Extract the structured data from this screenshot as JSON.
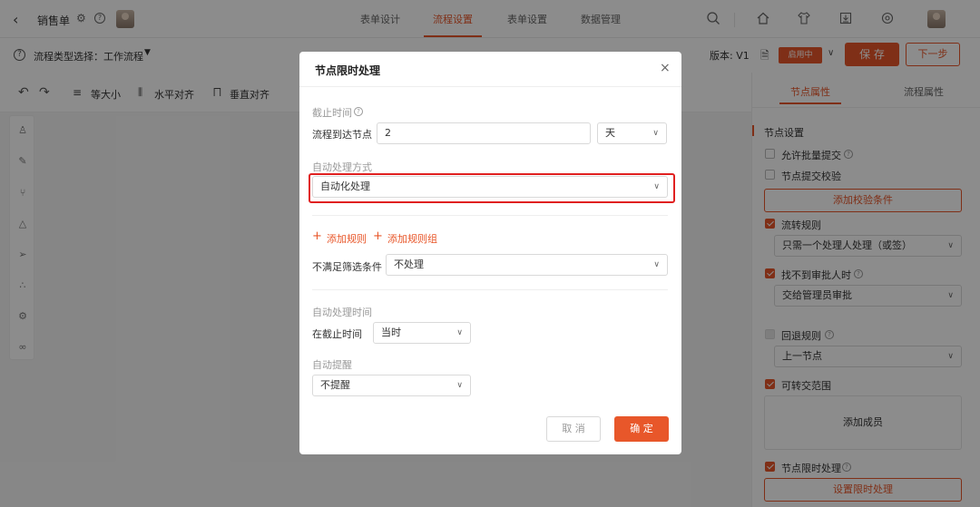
{
  "header": {
    "title": "销售单",
    "tabs": [
      {
        "label": "表单设计"
      },
      {
        "label": "流程设置"
      },
      {
        "label": "表单设置"
      },
      {
        "label": "数据管理"
      }
    ]
  },
  "subheader": {
    "flow_type_label": "流程类型选择：工作流程",
    "version_label": "版本: V1",
    "status_badge": "启用中",
    "save_label": "保 存",
    "next_label": "下一步"
  },
  "toolbar": {
    "same_size": "等大小",
    "h_align": "水平对齐",
    "v_align": "垂直对齐"
  },
  "right_panel": {
    "tabs": [
      {
        "label": "节点属性"
      },
      {
        "label": "流程属性"
      }
    ],
    "section_title": "节点设置",
    "allow_batch": "允许批量提交",
    "node_check": "节点提交校验",
    "add_check_button": "添加校验条件",
    "flow_rule_label": "流转规则",
    "flow_rule_value": "只需一个处理人处理（或签）",
    "no_approver_label": "找不到审批人时",
    "no_approver_value": "交给管理员审批",
    "return_rule_label": "回退规则",
    "return_rule_value": "上一节点",
    "transfer_scope_label": "可转交范围",
    "add_member": "添加成员",
    "time_limit_label": "节点限时处理",
    "set_time_limit_button": "设置限时处理"
  },
  "modal": {
    "title": "节点限时处理",
    "deadline_label": "截止时间",
    "arrive_node_label": "流程到达节点",
    "arrive_value": "2",
    "unit_value": "天",
    "auto_mode_label": "自动处理方式",
    "auto_mode_value": "自动化处理",
    "add_rule": "添加规则",
    "add_rule_group": "添加规则组",
    "unmatched_label": "不满足筛选条件",
    "unmatched_value": "不处理",
    "auto_time_label": "自动处理时间",
    "at_deadline_label": "在截止时间",
    "at_deadline_value": "当时",
    "auto_remind_label": "自动提醒",
    "auto_remind_value": "不提醒",
    "cancel_label": "取 消",
    "confirm_label": "确 定"
  },
  "colors": {
    "accent": "#e8572a",
    "highlight": "#e02020"
  },
  "icons": [
    "back-icon",
    "gear-icon",
    "help-icon",
    "search-icon",
    "home-icon",
    "shirt-icon",
    "download-icon",
    "settings-circle-icon",
    "undo-icon",
    "redo-icon",
    "close-icon",
    "chevron-down-icon",
    "plus-icon",
    "document-icon"
  ]
}
